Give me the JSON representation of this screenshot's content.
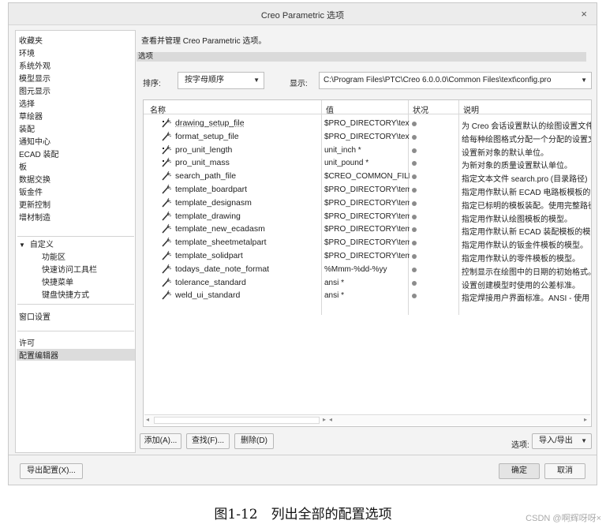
{
  "window": {
    "title": "Creo Parametric 选项",
    "close_glyph": "×"
  },
  "nav": {
    "items_top": [
      "收藏夹",
      "环境",
      "系统外观",
      "模型显示",
      "图元显示",
      "选择",
      "草绘器",
      "装配",
      "通知中心",
      "ECAD 装配",
      "板",
      "数据交换",
      "钣金件",
      "更新控制",
      "增材制造"
    ],
    "custom_group": "自定义",
    "custom_items": [
      "功能区",
      "快速访问工具栏",
      "快捷菜单",
      "键盘快捷方式"
    ],
    "window_settings": "窗口设置",
    "license": "许可",
    "config_editor": "配置编辑器"
  },
  "main": {
    "description": "查看并管理 Creo Parametric 选项。",
    "section_label": "选项",
    "sort_label": "排序:",
    "sort_value": "按字母顺序",
    "show_label": "显示:",
    "show_value": "C:\\Program Files\\PTC\\Creo 6.0.0.0\\Common Files\\text\\config.pro",
    "columns": {
      "name": "名称",
      "value": "值",
      "status": "状况",
      "description": "说明"
    },
    "rows": [
      {
        "name": "drawing_setup_file",
        "value": "$PRO_DIRECTORY\\text",
        "description": "为 Creo 会话设置默认的绘图设置文件",
        "icon": "wand-star-icon"
      },
      {
        "name": "format_setup_file",
        "value": "$PRO_DIRECTORY\\text",
        "description": "给每种绘图格式分配一个分配的设置文件",
        "icon": "wand-icon"
      },
      {
        "name": "pro_unit_length",
        "value": "unit_inch *",
        "description": "设置新对象的默认单位。",
        "icon": "wand-star-icon"
      },
      {
        "name": "pro_unit_mass",
        "value": "unit_pound *",
        "description": "为新对象的质量设置默认单位。",
        "icon": "wand-star-icon"
      },
      {
        "name": "search_path_file",
        "value": "$CREO_COMMON_FILES",
        "description": "指定文本文件 search.pro (目录路径)",
        "icon": "wand-icon"
      },
      {
        "name": "template_boardpart",
        "value": "$PRO_DIRECTORY\\templates",
        "description": "指定用作默认新 ECAD 电路板模板的",
        "icon": "wand-icon"
      },
      {
        "name": "template_designasm",
        "value": "$PRO_DIRECTORY\\templates",
        "description": "指定已标明的模板装配。使用完整路径",
        "icon": "wand-icon"
      },
      {
        "name": "template_drawing",
        "value": "$PRO_DIRECTORY\\templates",
        "description": "指定用作默认绘图模板的模型。",
        "icon": "wand-icon"
      },
      {
        "name": "template_new_ecadasm",
        "value": "$PRO_DIRECTORY\\templates",
        "description": "指定用作默认新 ECAD 装配模板的模",
        "icon": "wand-icon"
      },
      {
        "name": "template_sheetmetalpart",
        "value": "$PRO_DIRECTORY\\templates",
        "description": "指定用作默认的钣金件模板的模型。",
        "icon": "wand-icon"
      },
      {
        "name": "template_solidpart",
        "value": "$PRO_DIRECTORY\\templates",
        "description": "指定用作默认的零件模板的模型。",
        "icon": "wand-icon"
      },
      {
        "name": "todays_date_note_format",
        "value": "%Mmm-%dd-%yy",
        "description": "控制显示在绘图中的日期的初始格式。",
        "icon": "wand-icon"
      },
      {
        "name": "tolerance_standard",
        "value": "ansi *",
        "description": "设置创建模型时使用的公差标准。",
        "icon": "wand-icon"
      },
      {
        "name": "weld_ui_standard",
        "value": "ansi *",
        "description": "指定焊接用户界面标准。ANSI - 使用",
        "icon": "wand-icon"
      }
    ],
    "buttons": {
      "add": "添加(A)...",
      "find": "查找(F)...",
      "delete": "删除(D)"
    },
    "options_label": "选项:",
    "import_export": "导入/导出"
  },
  "footer": {
    "export": "导出配置(X)...",
    "ok": "确定",
    "cancel": "取消"
  },
  "caption": "图1-12　列出全部的配置选项",
  "watermark": "CSDN @啊辉呀呀×"
}
